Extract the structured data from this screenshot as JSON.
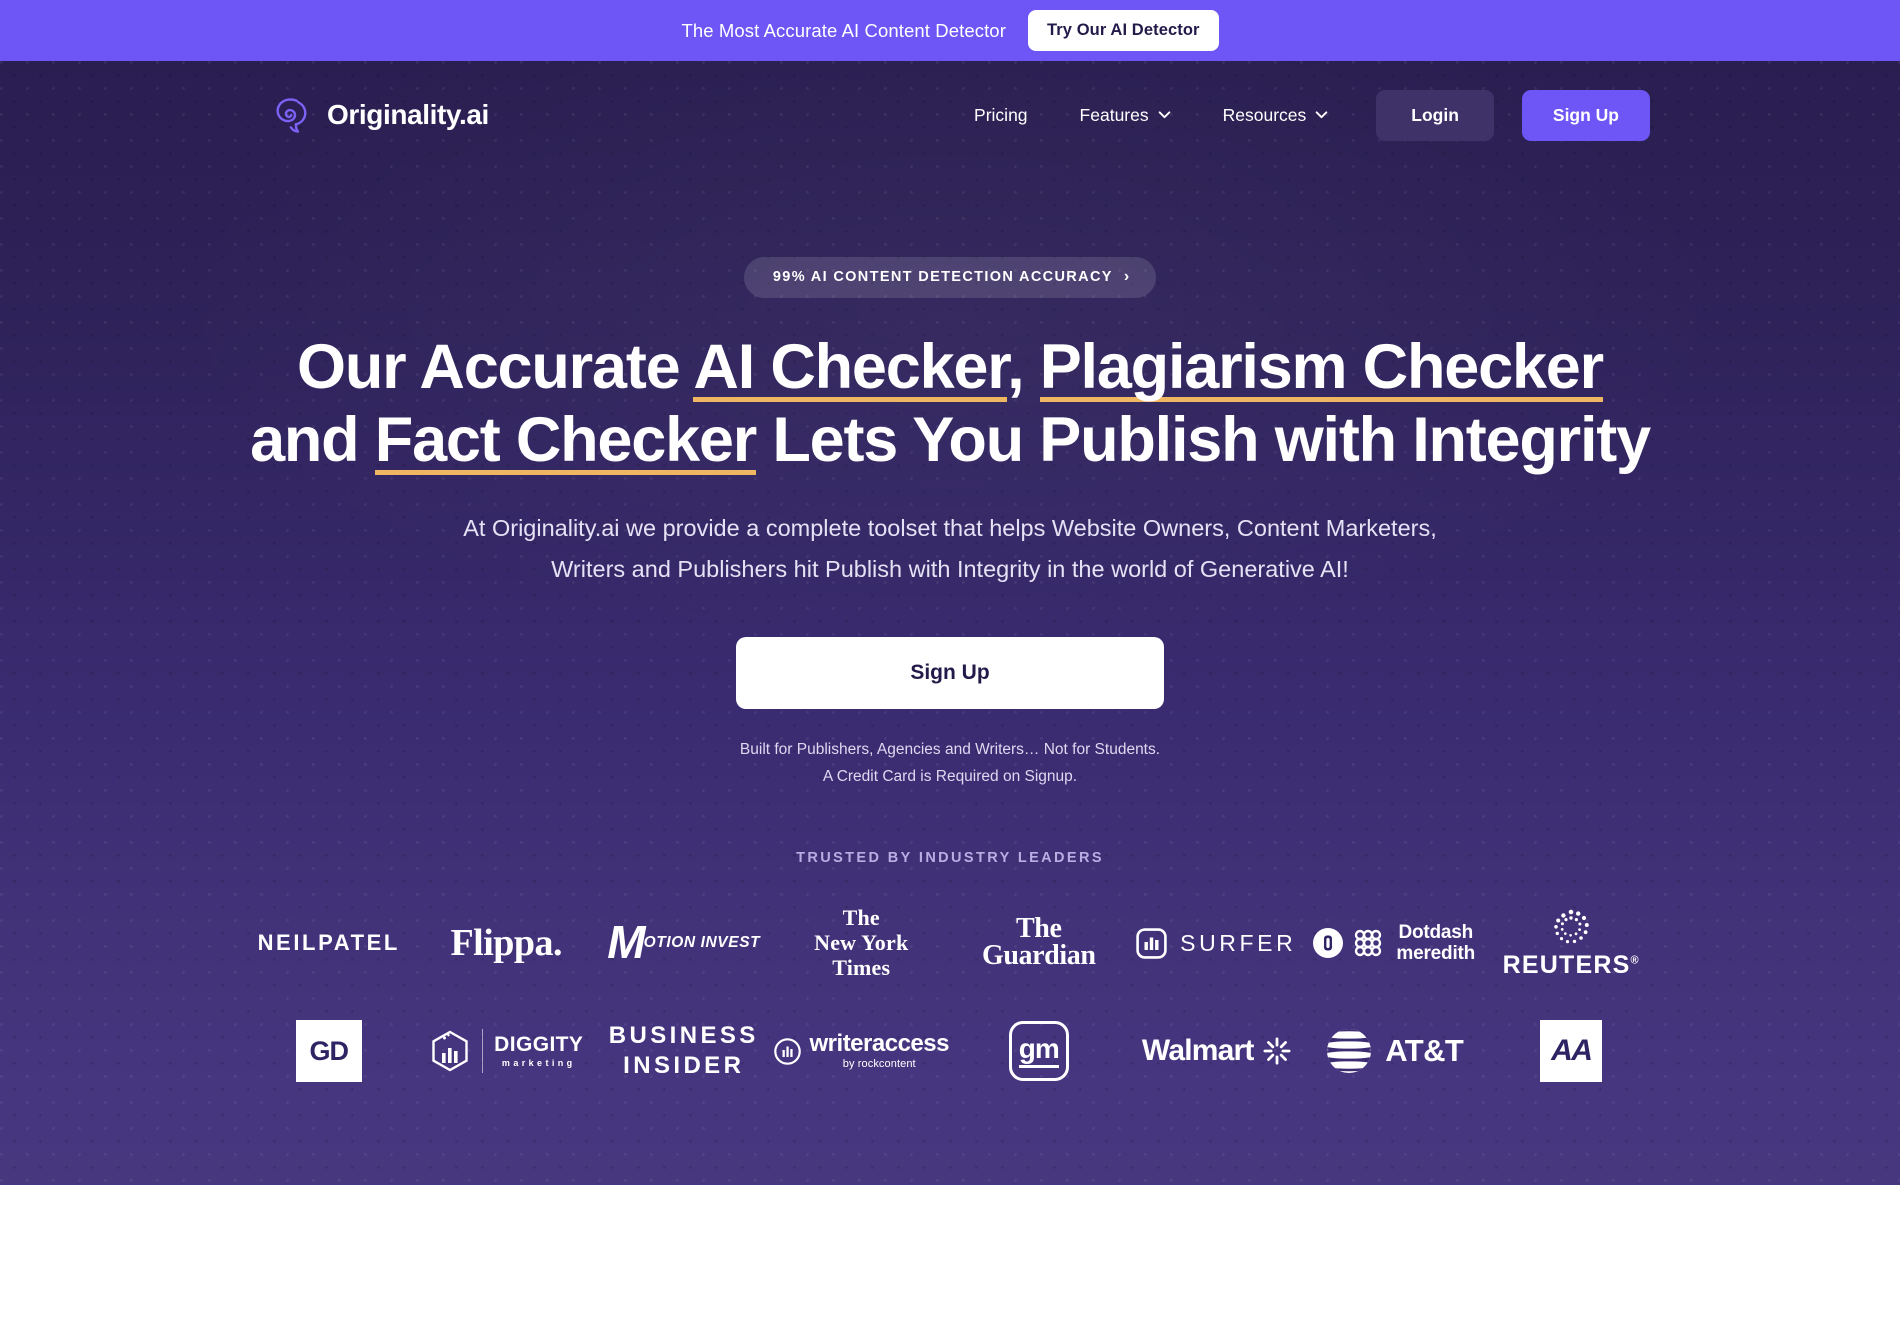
{
  "top_banner": {
    "text": "The Most Accurate AI Content Detector",
    "button_label": "Try Our AI Detector",
    "background_color": "#6d56f5"
  },
  "nav": {
    "brand_name": "Originality.ai",
    "brand_logo_icon": "brain-speech-bubble-icon",
    "links": [
      {
        "label": "Pricing",
        "has_dropdown": false
      },
      {
        "label": "Features",
        "has_dropdown": true
      },
      {
        "label": "Resources",
        "has_dropdown": true
      }
    ],
    "login_label": "Login",
    "signup_label": "Sign Up"
  },
  "hero": {
    "eyebrow": {
      "text": "99% AI CONTENT DETECTION ACCURACY",
      "arrow": "›"
    },
    "headline": {
      "line1_pre": "Our Accurate ",
      "line1_u1": "AI Checker",
      "line1_mid": ", ",
      "line1_u2": "Plagiarism Checker",
      "line2_pre": "and ",
      "line2_u1": "Fact Checker",
      "line2_post": " Lets You Publish with Integrity"
    },
    "subhead": {
      "pre": "At Originality.ai we provide a complete toolset that helps Website Owners, Content Marketers, Writers and Publishers hit ",
      "link": "Publish with Integrity",
      "post": " in the world of Generative AI!"
    },
    "cta_label": "Sign Up",
    "fineprint_line1": "Built for Publishers, Agencies and Writers… Not for Students.",
    "fineprint_line2": "A Credit Card is Required on Signup.",
    "underline_color": "#f0b763",
    "background_gradient_top": "#2a1e51",
    "background_gradient_bottom": "#47377f"
  },
  "trusted": {
    "label": "TRUSTED BY INDUSTRY LEADERS",
    "logos": [
      {
        "name": "NEILPATEL",
        "icon": "neilpatel-logo"
      },
      {
        "name": "Flippa.",
        "icon": "flippa-logo"
      },
      {
        "name": "MOTION INVEST",
        "icon": "motion-invest-logo"
      },
      {
        "name": "The New York Times",
        "icon": "new-york-times-logo"
      },
      {
        "name": "The Guardian",
        "icon": "the-guardian-logo"
      },
      {
        "name": "SURFER",
        "icon": "surfer-logo"
      },
      {
        "name": "Dotdash meredith",
        "icon": "dotdash-meredith-logo"
      },
      {
        "name": "REUTERS",
        "icon": "reuters-logo"
      },
      {
        "name": "GD",
        "icon": "gd-logo"
      },
      {
        "name": "DIGGITY marketing",
        "icon": "diggity-marketing-logo"
      },
      {
        "name": "BUSINESS INSIDER",
        "icon": "business-insider-logo"
      },
      {
        "name": "writeraccess by rockcontent",
        "icon": "writeraccess-logo"
      },
      {
        "name": "gm",
        "icon": "gm-logo"
      },
      {
        "name": "Walmart",
        "icon": "walmart-logo"
      },
      {
        "name": "AT&T",
        "icon": "att-logo"
      },
      {
        "name": "AA",
        "icon": "american-airlines-logo"
      }
    ],
    "nyt_line1": "The",
    "nyt_line2": "New York",
    "nyt_line3": "Times",
    "guardian_line1": "The",
    "guardian_line2": "Guardian",
    "dotdash_line1": "Dotdash",
    "dotdash_line2": "meredith",
    "bi_line1": "BUSINESS",
    "bi_line2": "INSIDER",
    "diggity_line1": "DIGGITY",
    "diggity_line2": "marketing",
    "writeaccess_line1": "writeraccess",
    "writeaccess_line2": "by rockcontent",
    "motion_m": "M",
    "motion_rest": "OTION INVEST",
    "reuters_mark": "REUTERS",
    "reuters_sup": "®",
    "walmart_text": "Walmart",
    "att_text": "AT&T",
    "gd_text": "GD",
    "aa_text": "AA",
    "neilpatel_text": "NEILPATEL",
    "flippa_text": "Flippa.",
    "surfer_text": "SURFER",
    "gm_text": "gm"
  }
}
